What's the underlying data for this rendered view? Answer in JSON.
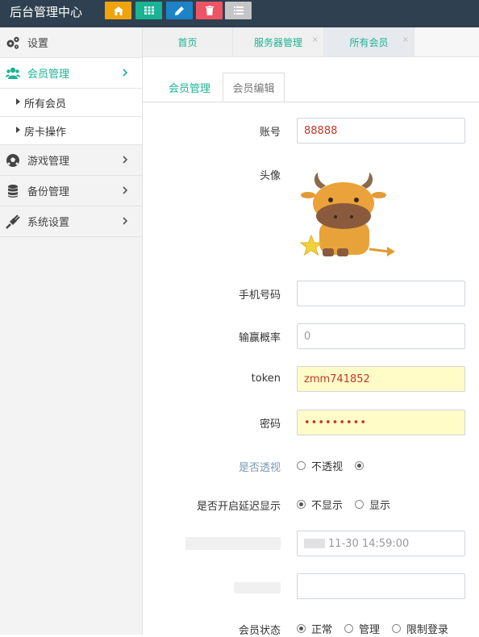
{
  "app": {
    "title": "后台管理中心"
  },
  "toolbar": {
    "buttons": [
      {
        "icon": "home-icon",
        "color": "#f0a30a"
      },
      {
        "icon": "grid-icon",
        "color": "#1ab394"
      },
      {
        "icon": "pencil-icon",
        "color": "#1c84c6"
      },
      {
        "icon": "trash-icon",
        "color": "#ed5565"
      },
      {
        "icon": "list-icon",
        "color": "#c5c5c5"
      }
    ]
  },
  "sidebar": {
    "items": [
      {
        "label": "设置",
        "icon": "gears-icon"
      },
      {
        "label": "会员管理",
        "icon": "users-icon",
        "active": true
      },
      {
        "label": "所有会员"
      },
      {
        "label": "房卡操作"
      },
      {
        "label": "游戏管理",
        "icon": "soccer-ball-icon"
      },
      {
        "label": "备份管理",
        "icon": "database-icon"
      },
      {
        "label": "系统设置",
        "icon": "plug-icon"
      }
    ]
  },
  "tabs": [
    {
      "label": "首页"
    },
    {
      "label": "服务器管理",
      "close": "×"
    },
    {
      "label": "所有会员",
      "close": "×"
    }
  ],
  "form_tabs": [
    {
      "label": "会员管理"
    },
    {
      "label": "会员编辑"
    }
  ],
  "form": {
    "account": {
      "label": "账号",
      "value": "88888"
    },
    "avatar": {
      "label": "头像"
    },
    "phone": {
      "label": "手机号码",
      "value": ""
    },
    "win_rate": {
      "label": "输赢概率",
      "value": "0"
    },
    "token": {
      "label": "token",
      "value": "zmm741852"
    },
    "password": {
      "label": "密码",
      "value": "•••••••••"
    },
    "see_through": {
      "label": "是否透视",
      "options": [
        "不透视"
      ],
      "selected": ""
    },
    "delay_display": {
      "label": "是否开启延迟显示",
      "options": [
        "不显示",
        "显示"
      ],
      "selected": "不显示"
    },
    "date": {
      "value": "11-30 14:59:00"
    },
    "member_status": {
      "label": "会员状态",
      "options": [
        "正常",
        "管理",
        "限制登录"
      ],
      "selected": "正常"
    }
  },
  "colors": {
    "accent": "#1ab394",
    "topbar": "#2f4050",
    "highlight": "#fffcc8"
  }
}
